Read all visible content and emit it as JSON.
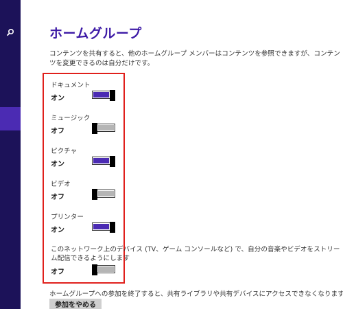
{
  "page": {
    "title": "ホームグループ",
    "description": "コンテンツを共有すると、他のホームグループ メンバーはコンテンツを参照できますが、コンテンツを変更できるのは自分だけです。"
  },
  "settings": [
    {
      "label": "ドキュメント",
      "state": "オン",
      "on": true
    },
    {
      "label": "ミュージック",
      "state": "オフ",
      "on": false
    },
    {
      "label": "ピクチャ",
      "state": "オン",
      "on": true
    },
    {
      "label": "ビデオ",
      "state": "オフ",
      "on": false
    },
    {
      "label": "プリンター",
      "state": "オン",
      "on": true
    }
  ],
  "devices": {
    "label": "このネットワーク上のデバイス (TV、ゲーム コンソールなど) で、自分の音楽やビデオをストリーム配信できるようにします",
    "state": "オフ",
    "on": false
  },
  "leave": {
    "description": "ホームグループへの参加を終了すると、共有ライブラリや共有デバイスにアクセスできなくなります。",
    "button_label": "参加をやめる"
  },
  "colors": {
    "sidebar": "#1c1259",
    "sidebar_selected": "#4b2bb3",
    "title": "#3d1aa6",
    "toggle_on": "#4b2bb3",
    "toggle_off": "#b5b5b5",
    "highlight_box": "#e0201c"
  },
  "icons": {
    "sidebar_search": "search-icon"
  }
}
